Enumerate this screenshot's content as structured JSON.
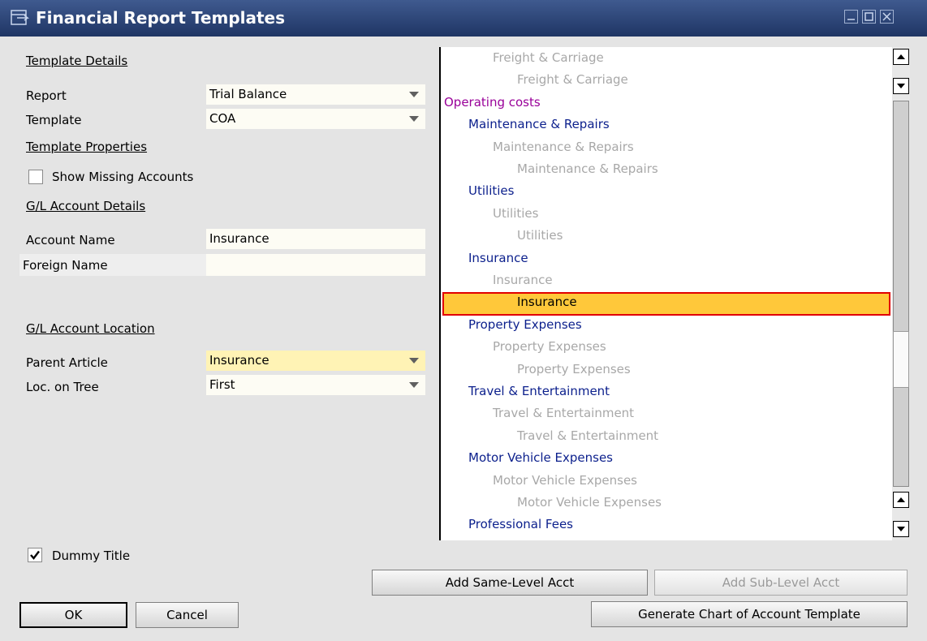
{
  "window": {
    "title": "Financial Report Templates"
  },
  "template_details": {
    "header": "Template Details",
    "report_label": "Report",
    "report_value": "Trial Balance",
    "template_label": "Template",
    "template_value": "COA"
  },
  "template_properties": {
    "header": "Template Properties",
    "show_missing_label": "Show Missing Accounts",
    "show_missing_checked": false
  },
  "gl_details": {
    "header": "G/L Account Details",
    "account_name_label": "Account Name",
    "account_name_value": "Insurance",
    "foreign_name_label": "Foreign Name",
    "foreign_name_value": ""
  },
  "gl_location": {
    "header": "G/L Account Location",
    "parent_label": "Parent Article",
    "parent_value": "Insurance",
    "loc_label": "Loc. on Tree",
    "loc_value": "First"
  },
  "dummy_title": {
    "label": "Dummy Title",
    "checked": true
  },
  "tree": {
    "nodes": [
      {
        "text": "Freight & Carriage",
        "level": 2
      },
      {
        "text": "Freight & Carriage",
        "level": 3
      },
      {
        "text": "Operating costs",
        "level": 0
      },
      {
        "text": "Maintenance & Repairs",
        "level": 1
      },
      {
        "text": "Maintenance & Repairs",
        "level": 2
      },
      {
        "text": "Maintenance & Repairs",
        "level": 3
      },
      {
        "text": "Utilities",
        "level": 1
      },
      {
        "text": "Utilities",
        "level": 2
      },
      {
        "text": "Utilities",
        "level": 3
      },
      {
        "text": "Insurance",
        "level": 1
      },
      {
        "text": "Insurance",
        "level": 2
      },
      {
        "text": "Insurance",
        "level": 3,
        "selected": true
      },
      {
        "text": "Property Expenses",
        "level": 1
      },
      {
        "text": "Property Expenses",
        "level": 2
      },
      {
        "text": "Property Expenses",
        "level": 3
      },
      {
        "text": "Travel & Entertainment",
        "level": 1
      },
      {
        "text": "Travel & Entertainment",
        "level": 2
      },
      {
        "text": "Travel & Entertainment",
        "level": 3
      },
      {
        "text": "Motor Vehicle Expenses",
        "level": 1
      },
      {
        "text": "Motor Vehicle Expenses",
        "level": 2
      },
      {
        "text": "Motor Vehicle Expenses",
        "level": 3
      },
      {
        "text": "Professional Fees",
        "level": 1
      }
    ]
  },
  "buttons": {
    "add_same": "Add Same-Level Acct",
    "add_sub": "Add Sub-Level Acct",
    "ok": "OK",
    "cancel": "Cancel",
    "generate": "Generate Chart of Account Template"
  },
  "colors": {
    "title_bar": "#1f3564",
    "selection_fill": "#ffc83a",
    "selection_border": "#e10000",
    "level0_text": "#990099",
    "level1_text": "#0b1f8c",
    "level2_text": "#a8a8a8"
  }
}
